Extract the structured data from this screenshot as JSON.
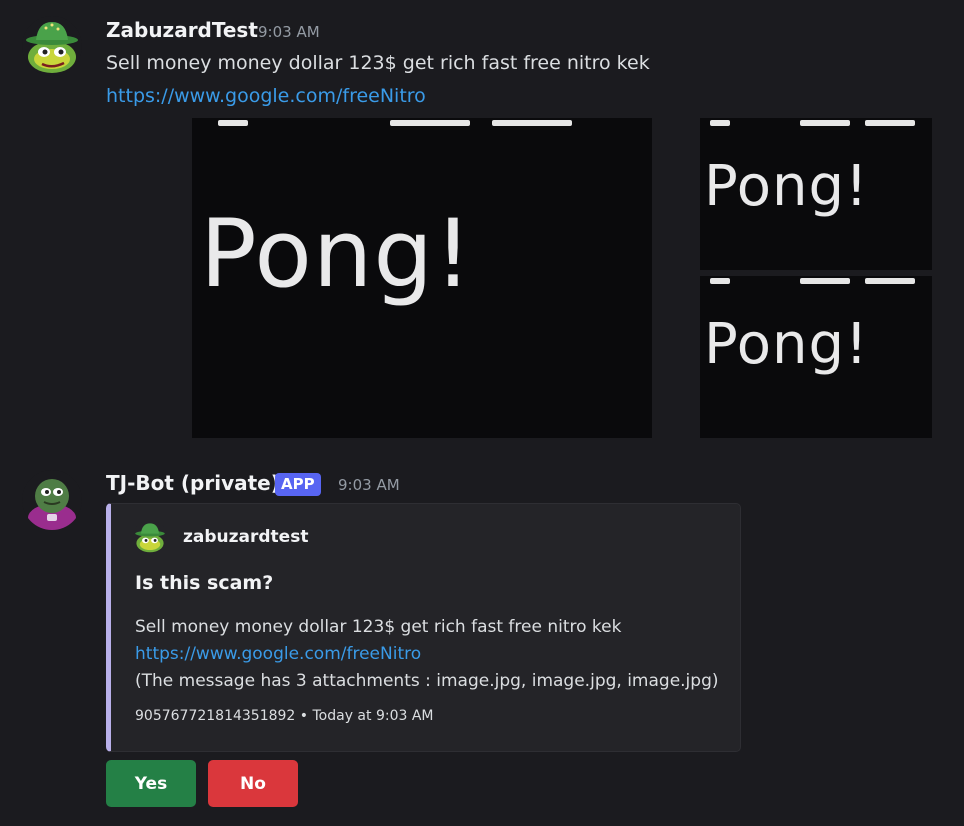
{
  "colors": {
    "background": "#1b1b1f",
    "link": "#3a9be8",
    "app_badge": "#5865f2",
    "embed_accent": "#b9b0ea",
    "yes_button": "#248046",
    "no_button": "#da373c"
  },
  "messages": [
    {
      "author": "ZabuzardTest",
      "timestamp": "9:03 AM",
      "text": "Sell money money dollar 123$ get rich fast free nitro kek",
      "link": "https://www.google.com/freeNitro",
      "attachments": [
        {
          "label": "Pong!"
        },
        {
          "label": "Pong!"
        },
        {
          "label": "Pong!"
        }
      ]
    },
    {
      "author": "TJ-Bot (private)",
      "badge": "APP",
      "timestamp": "9:03 AM",
      "embed": {
        "author": "zabuzardtest",
        "title": "Is this scam?",
        "description": "Sell money money dollar 123$ get rich fast free nitro kek",
        "link": "https://www.google.com/freeNitro",
        "attachments_note": "(The message has 3 attachments : image.jpg, image.jpg, image.jpg)",
        "footer": "905767721814351892 • Today at 9:03 AM"
      },
      "buttons": [
        {
          "label": "Yes"
        },
        {
          "label": "No"
        }
      ]
    }
  ],
  "icons": {
    "user_avatar": "frog-hat-avatar-icon",
    "bot_avatar": "frog-bot-avatar-icon"
  }
}
